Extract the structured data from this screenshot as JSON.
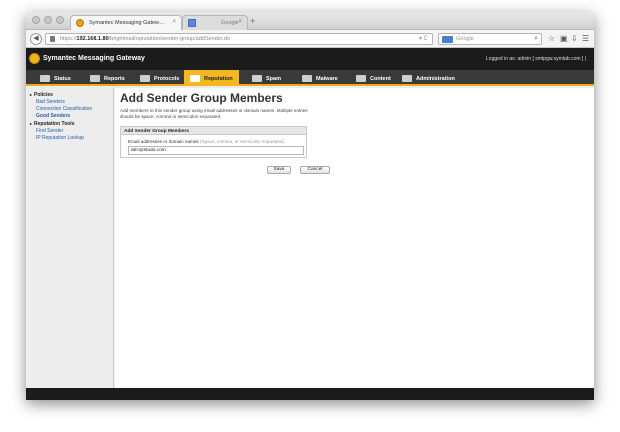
{
  "browser": {
    "tabs": [
      {
        "label": "Symantec Messaging Gatew…",
        "active": true
      },
      {
        "label": "Google",
        "active": false
      }
    ],
    "new_tab": "+",
    "tab_close": "×",
    "url": {
      "prefix": "https://",
      "host": "192.168.1.80",
      "path": "/brightmail/reputation/sender-group/addSender.do"
    },
    "url_reload": "▾ C",
    "search_placeholder": "Google",
    "icons": [
      "back-icon",
      "lock-icon",
      "search-engine-icon",
      "magnifier-icon",
      "star-icon",
      "reading-list-icon",
      "download-icon",
      "home-icon",
      "menu-icon"
    ]
  },
  "app": {
    "brand": "Symantec Messaging Gateway",
    "logged_in": "Logged in as: admin [ smtpgw.symtab.com ]  |",
    "colors": {
      "accent": "#f5b71e",
      "header_bg": "#1b1b1b",
      "menu_bg": "#3a3a3a",
      "link": "#1f5fa8"
    }
  },
  "menu": [
    {
      "label": "Status",
      "icon": "status-icon"
    },
    {
      "label": "Reports",
      "icon": "reports-icon"
    },
    {
      "label": "Protocols",
      "icon": "protocols-icon"
    },
    {
      "label": "Reputation",
      "icon": "reputation-icon",
      "active": true
    },
    {
      "label": "Spam",
      "icon": "spam-icon"
    },
    {
      "label": "Malware",
      "icon": "malware-icon"
    },
    {
      "label": "Content",
      "icon": "content-icon"
    },
    {
      "label": "Administration",
      "icon": "administration-icon"
    }
  ],
  "sidebar": {
    "groups": [
      {
        "label": "Policies",
        "items": [
          "Bad Senders",
          "Connection Classification",
          "Good Senders"
        ]
      },
      {
        "label": "Reputation Tools",
        "items": [
          "Find Sender",
          "IP Reputation Lookup"
        ]
      }
    ],
    "current": "Good Senders",
    "expander": "▸"
  },
  "main": {
    "title": "Add Sender Group Members",
    "description": "Add members to this sender group using email addresses or domain names. Multiple entries should be space, comma or semicolon separated.",
    "panel_title": "Add Sender Group Members",
    "field_label": "Email addresses or domain names",
    "field_hint": "(Space, comma, or semicolon separated)",
    "field_value": "abc@studo.com",
    "save_label": "Save",
    "cancel_label": "Cancel"
  }
}
